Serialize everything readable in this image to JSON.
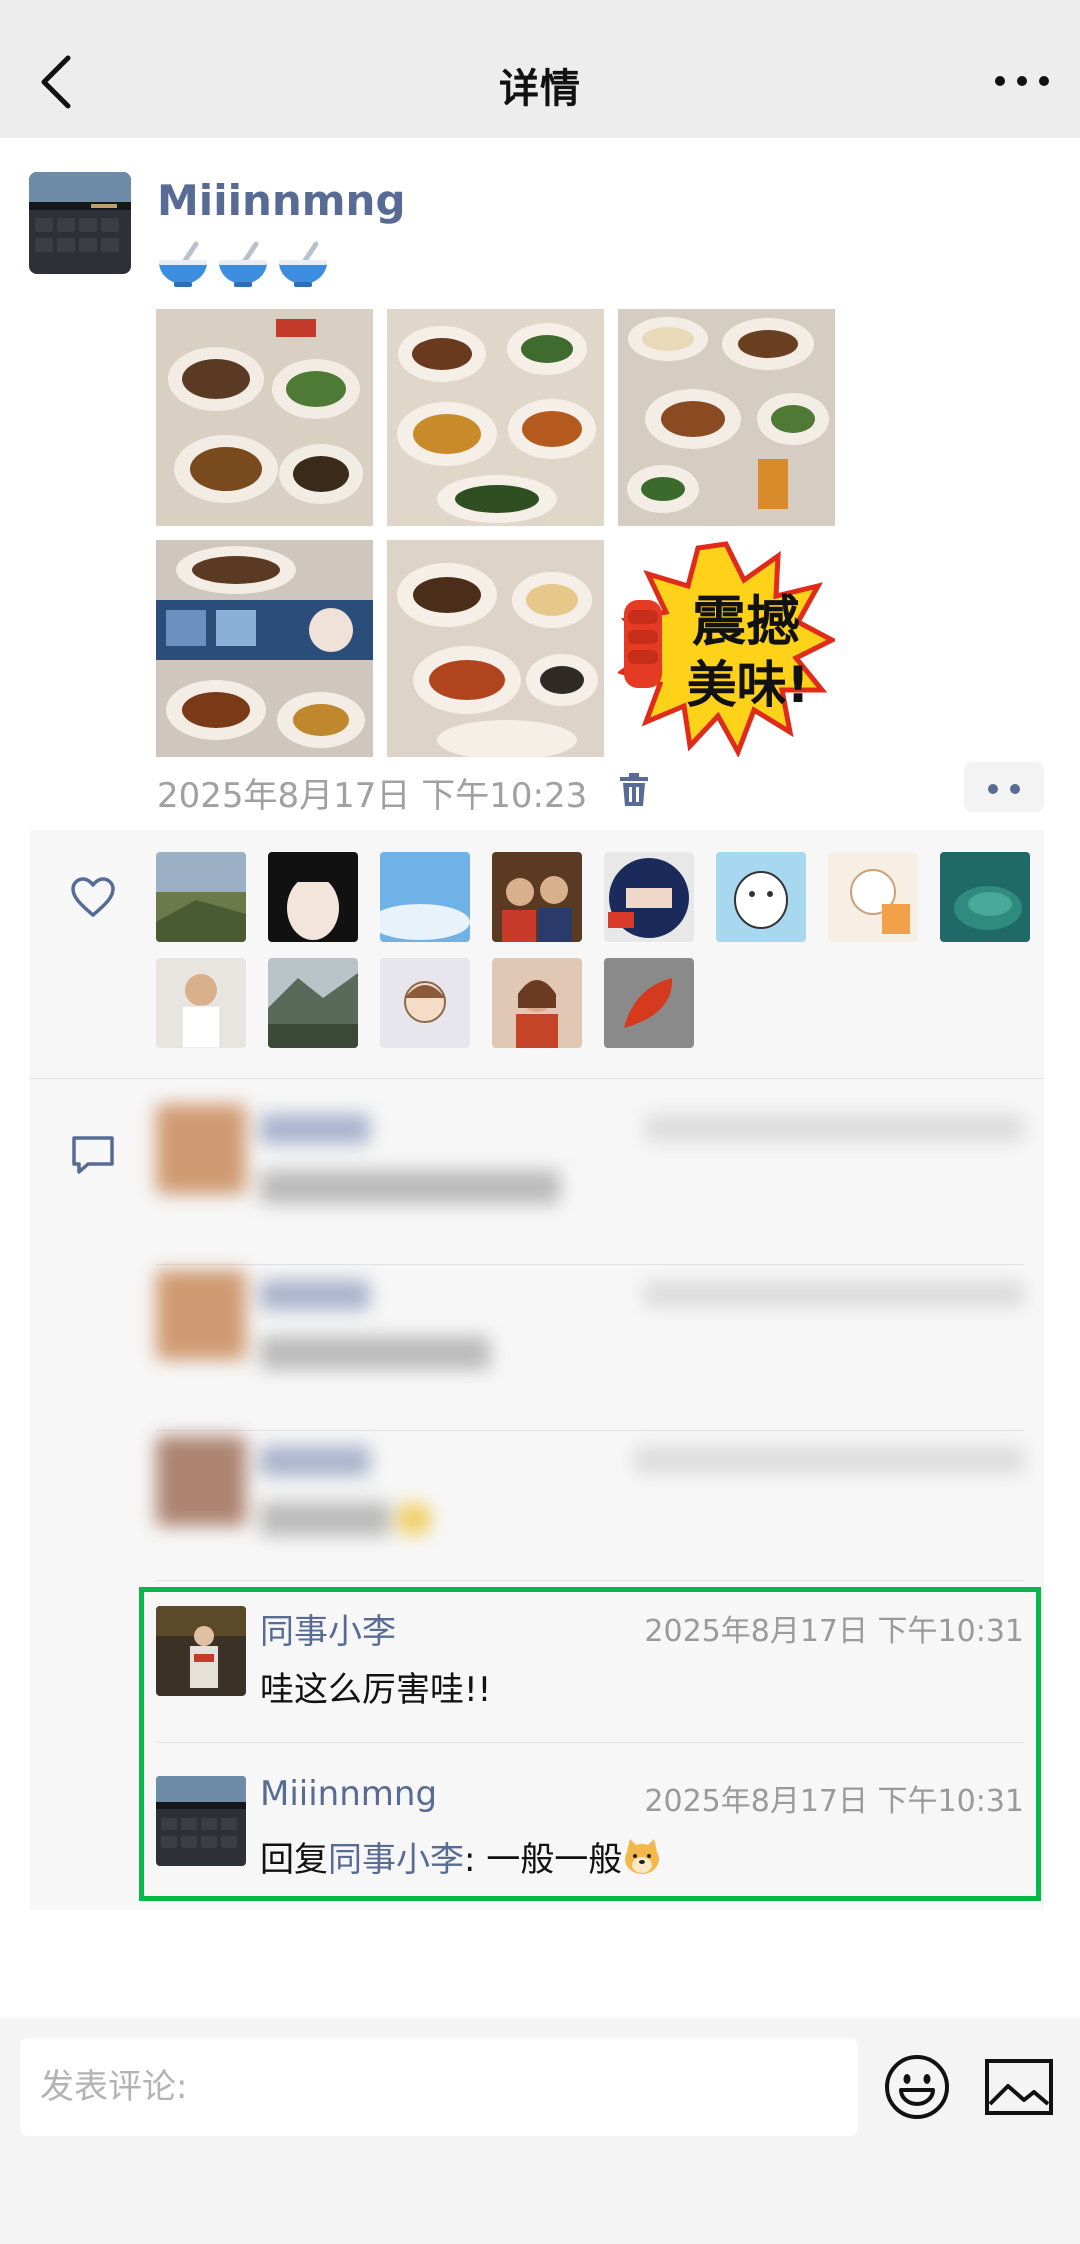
{
  "header": {
    "title": "详情",
    "back_icon": "chevron-left-icon",
    "more_icon": "more-dots-icon"
  },
  "post": {
    "author": "Miiinnmng",
    "text_icons": [
      "bowl-with-spoon-icon",
      "bowl-with-spoon-icon",
      "bowl-with-spoon-icon"
    ],
    "photos": [
      "food-photo-1",
      "food-photo-2",
      "food-photo-3",
      "food-photo-4",
      "food-photo-5",
      "sticker-photo"
    ],
    "sticker_text": [
      "震撼",
      "美味!"
    ],
    "timestamp": "2025年8月17日 下午10:23",
    "delete_icon": "trash-icon",
    "action_icon": "two-dots-icon"
  },
  "likes": {
    "icon": "heart-icon",
    "count": 13
  },
  "comments": {
    "icon": "comment-icon",
    "items": [
      {
        "name": "同事小李",
        "time": "2025年8月17日 下午10:31",
        "text": "哇这么厉害哇!!"
      },
      {
        "name": "Miiinnmng",
        "time": "2025年8月17日 下午10:31",
        "reply_prefix": "回复",
        "reply_to": "同事小李",
        "reply_text": ": 一般一般",
        "emoji": "doge-emoji"
      }
    ]
  },
  "input": {
    "placeholder": "发表评论:",
    "value": "",
    "emoji_icon": "smiley-icon",
    "image_icon": "image-icon"
  },
  "colors": {
    "link": "#576b95",
    "highlight": "#08b84a",
    "header_bg": "#ededed"
  }
}
